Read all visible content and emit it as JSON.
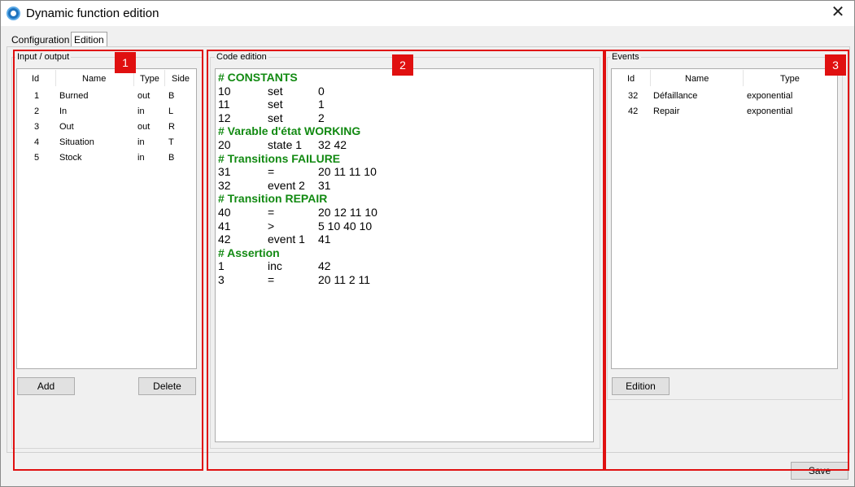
{
  "window": {
    "title": "Dynamic function edition",
    "close_glyph": "✕"
  },
  "tabs": [
    {
      "label": "Configuration"
    },
    {
      "label": "Edition",
      "selected": true
    }
  ],
  "io_panel": {
    "title": "Input / output",
    "columns": [
      "Id",
      "Name",
      "Type",
      "Side"
    ],
    "rows": [
      {
        "id": "1",
        "name": "Burned",
        "type": "out",
        "side": "B"
      },
      {
        "id": "2",
        "name": "In",
        "type": "in",
        "side": "L"
      },
      {
        "id": "3",
        "name": "Out",
        "type": "out",
        "side": "R"
      },
      {
        "id": "4",
        "name": "Situation",
        "type": "in",
        "side": "T"
      },
      {
        "id": "5",
        "name": "Stock",
        "type": "in",
        "side": "B"
      }
    ],
    "add_label": "Add",
    "delete_label": "Delete"
  },
  "code_panel": {
    "title": "Code edition",
    "lines": [
      {
        "kind": "comment",
        "text": "# CONSTANTS"
      },
      {
        "kind": "code",
        "a": "10",
        "b": "set",
        "c": "0"
      },
      {
        "kind": "code",
        "a": "11",
        "b": "set",
        "c": "1"
      },
      {
        "kind": "code",
        "a": "12",
        "b": "set",
        "c": "2"
      },
      {
        "kind": "comment",
        "text": "# Varable d'état WORKING"
      },
      {
        "kind": "code",
        "a": "20",
        "b": "state 1",
        "c": "32 42"
      },
      {
        "kind": "comment",
        "text": "# Transitions FAILURE"
      },
      {
        "kind": "code",
        "a": "31",
        "b": "=",
        "c": "20 11 11 10"
      },
      {
        "kind": "code",
        "a": "32",
        "b": "event 2",
        "c": "31"
      },
      {
        "kind": "comment",
        "text": "# Transition REPAIR"
      },
      {
        "kind": "code",
        "a": "40",
        "b": "=",
        "c": "20 12 11 10"
      },
      {
        "kind": "code",
        "a": "41",
        "b": ">",
        "c": "5 10 40 10"
      },
      {
        "kind": "code",
        "a": "42",
        "b": "event 1",
        "c": "41"
      },
      {
        "kind": "comment",
        "text": "# Assertion"
      },
      {
        "kind": "code",
        "a": "1",
        "b": "inc",
        "c": "42"
      },
      {
        "kind": "code",
        "a": "3",
        "b": "=",
        "c": "20 11 2 11"
      }
    ]
  },
  "events_panel": {
    "title": "Events",
    "columns": [
      "Id",
      "Name",
      "Type"
    ],
    "rows": [
      {
        "id": "32",
        "name": "Défaillance",
        "type": "exponential"
      },
      {
        "id": "42",
        "name": "Repair",
        "type": "exponential"
      }
    ],
    "edition_label": "Edition"
  },
  "save_label": "Save",
  "annotations": [
    "1",
    "2",
    "3"
  ],
  "colors": {
    "highlight": "#e01010",
    "comment": "#128a12",
    "app_icon": "#1e73be"
  }
}
